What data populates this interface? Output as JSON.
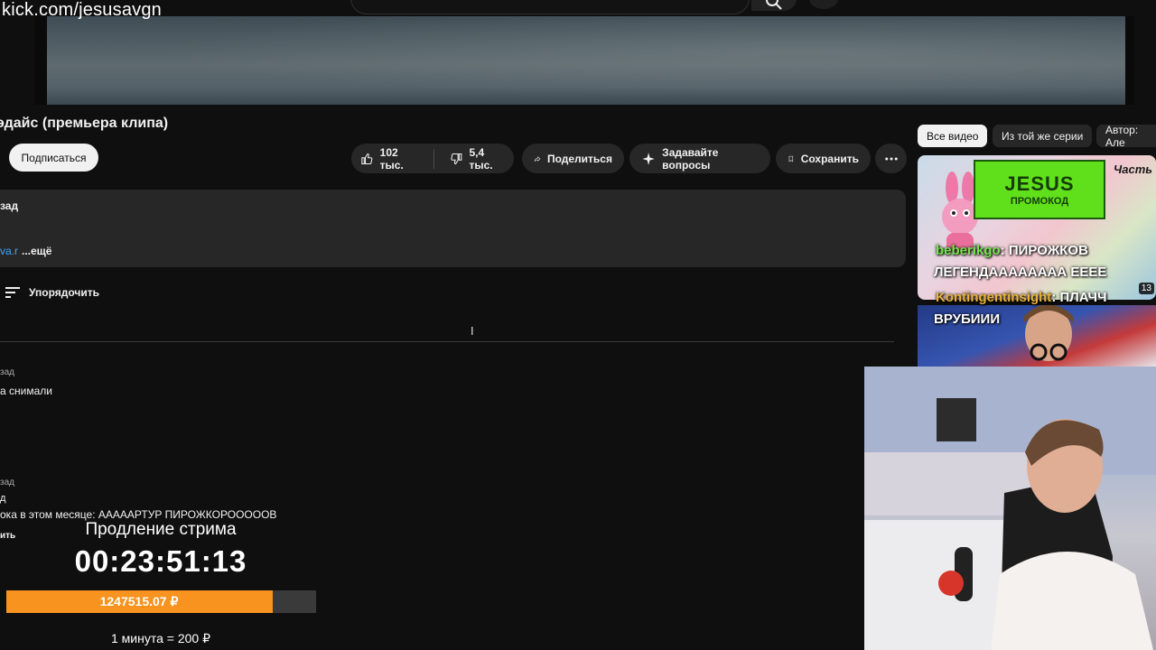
{
  "overlay": {
    "channel_url": "kick.com/jesusavgn",
    "extension_title": "Продление стрима",
    "timer": "00:23:51:13",
    "donation_amount": "1247515.07 ₽",
    "progress_fraction": 0.86,
    "rate": "1 минута = 200 ₽"
  },
  "video": {
    "title": "эдайс (премьера клипа)",
    "subscribe_label": "Подписаться"
  },
  "actions": {
    "likes": "102 тыс.",
    "dislikes": "5,4 тыс.",
    "share": "Поделиться",
    "ask": "Задавайте вопросы",
    "save": "Сохранить"
  },
  "description": {
    "ago": "зад",
    "link_fragment": "va.r",
    "more": "...ещё"
  },
  "comments": {
    "sort_label": "Упорядочить",
    "items": [
      {
        "meta": "зад",
        "text": "а снимали"
      },
      {
        "meta": "зад",
        "author": "д",
        "text": "ока в этом месяце: АААААРТУР ПИРОЖКОРОООООВ",
        "action": "ить"
      }
    ]
  },
  "filters": {
    "chips": [
      "Все видео",
      "Из той же серии",
      "Автор: Але"
    ]
  },
  "recommended": {
    "promo_big": "JESUS",
    "promo_small": "ПРОМОКОД",
    "part_label": "Часть",
    "duration": "13"
  },
  "chat": [
    {
      "user": "beberikgo",
      "message": ": ПИРОЖКОВ"
    },
    {
      "user": "",
      "message": "ЛЕГЕНДАААААААА ЕЕЕЕ"
    },
    {
      "user": "Kontingentinsight",
      "message": ": ПЛАЧЧ"
    },
    {
      "user": "",
      "message": "ВРУБИИИ"
    }
  ],
  "colors": {
    "background": "#0f0f0f",
    "pill": "#272727",
    "progress": "#f7931e",
    "chat_user_green": "#74e64c",
    "chat_user_orange": "#e9b23a",
    "promo_green": "#5fe01a"
  }
}
